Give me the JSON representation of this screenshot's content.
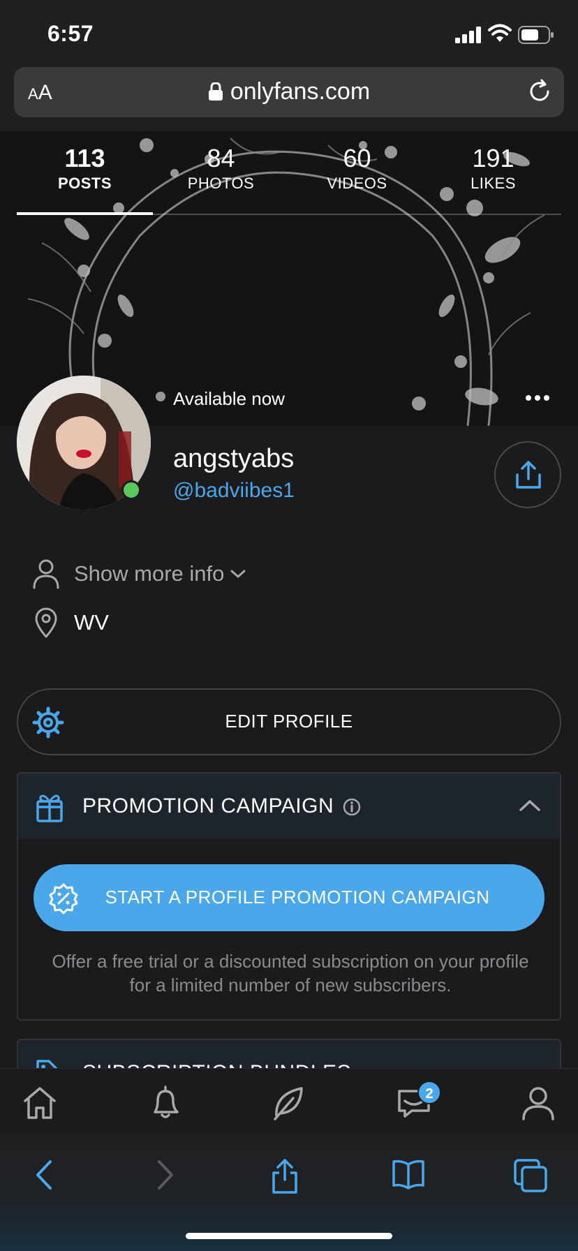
{
  "status": {
    "time": "6:57"
  },
  "browser": {
    "text_size_label": "AA",
    "url": "onlyfans.com"
  },
  "stats": [
    {
      "value": "113",
      "label": "POSTS",
      "active": true
    },
    {
      "value": "84",
      "label": "PHOTOS",
      "active": false
    },
    {
      "value": "60",
      "label": "VIDEOS",
      "active": false
    },
    {
      "value": "191",
      "label": "LIKES",
      "active": false
    }
  ],
  "profile": {
    "availability": "Available now",
    "display_name": "angstyabs",
    "username": "@badviibes1",
    "show_more_info": "Show more info",
    "location": "WV",
    "online": true
  },
  "actions": {
    "edit_profile": "EDIT PROFILE"
  },
  "promotion": {
    "title": "PROMOTION CAMPAIGN",
    "button": "START A PROFILE PROMOTION CAMPAIGN",
    "description": "Offer a free trial or a discounted subscription on your profile for a limited number of new subscribers."
  },
  "bundles": {
    "title": "SUBSCRIPTION BUNDLES"
  },
  "nav": {
    "items": [
      "home-icon",
      "bell-icon",
      "feather-icon",
      "messages-icon",
      "profile-icon"
    ],
    "messages_badge": "2"
  },
  "toolbar": {
    "items": [
      "back-icon",
      "forward-icon",
      "share-icon",
      "bookmarks-icon",
      "tabs-icon"
    ]
  },
  "colors": {
    "accent": "#4aa8ea",
    "background": "#1b1b1d",
    "online": "#5ac85a"
  }
}
